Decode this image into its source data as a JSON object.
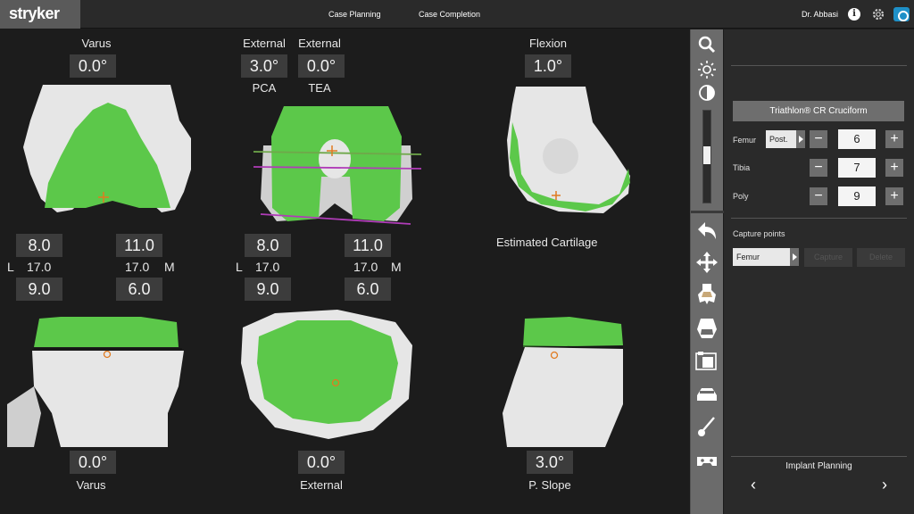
{
  "app": {
    "logo": "stryker"
  },
  "nav": {
    "case_planning": "Case Planning",
    "case_completion": "Case Completion"
  },
  "user": {
    "name": "Dr. Abbasi",
    "info_icon_glyph": "i"
  },
  "views": {
    "femur_frontal": {
      "title": "Varus",
      "value": "0.0°"
    },
    "femur_axial": {
      "title_left": "External",
      "title_right": "External",
      "value_left": "3.0°",
      "value_right": "0.0°",
      "sub_left": "PCA",
      "sub_right": "TEA"
    },
    "femur_sagittal": {
      "title": "Flexion",
      "value": "1.0°"
    },
    "gaps_left": {
      "top_left": "8.0",
      "top_right": "11.0",
      "l": "L",
      "mid_left": "17.0",
      "mid_right": "17.0",
      "m": "M",
      "bot_left": "9.0",
      "bot_right": "6.0"
    },
    "gaps_center": {
      "top_left": "8.0",
      "top_right": "11.0",
      "l": "L",
      "mid_left": "17.0",
      "mid_right": "17.0",
      "m": "M",
      "bot_left": "9.0",
      "bot_right": "6.0"
    },
    "cartilage": "Estimated Cartilage",
    "tibia_frontal": {
      "value": "0.0°",
      "label": "Varus"
    },
    "tibia_axial": {
      "value": "0.0°",
      "label": "External"
    },
    "tibia_sagittal": {
      "value": "3.0°",
      "label": "P. Slope"
    }
  },
  "panel": {
    "implant": "Triathlon® CR Cruciform",
    "femur": {
      "label": "Femur",
      "option": "Post.",
      "value": "6"
    },
    "tibia": {
      "label": "Tibia",
      "value": "7"
    },
    "poly": {
      "label": "Poly",
      "value": "9"
    },
    "minus": "−",
    "plus": "+",
    "capture_title": "Capture points",
    "capture_select": "Femur",
    "capture_btn": "Capture",
    "delete_btn": "Delete",
    "footer_title": "Implant Planning",
    "prev": "‹",
    "next": "›"
  },
  "colors": {
    "implant_green": "#5cc84a",
    "bone": "#e6e6e6",
    "accent": "#1e90c8"
  },
  "toolbar_icons": [
    "search-icon",
    "brightness-icon",
    "contrast-icon",
    "undo-icon",
    "move-icon",
    "femur-icon",
    "tibia-icon",
    "camera-icon",
    "car-icon",
    "probe-icon",
    "gamepad-icon"
  ]
}
